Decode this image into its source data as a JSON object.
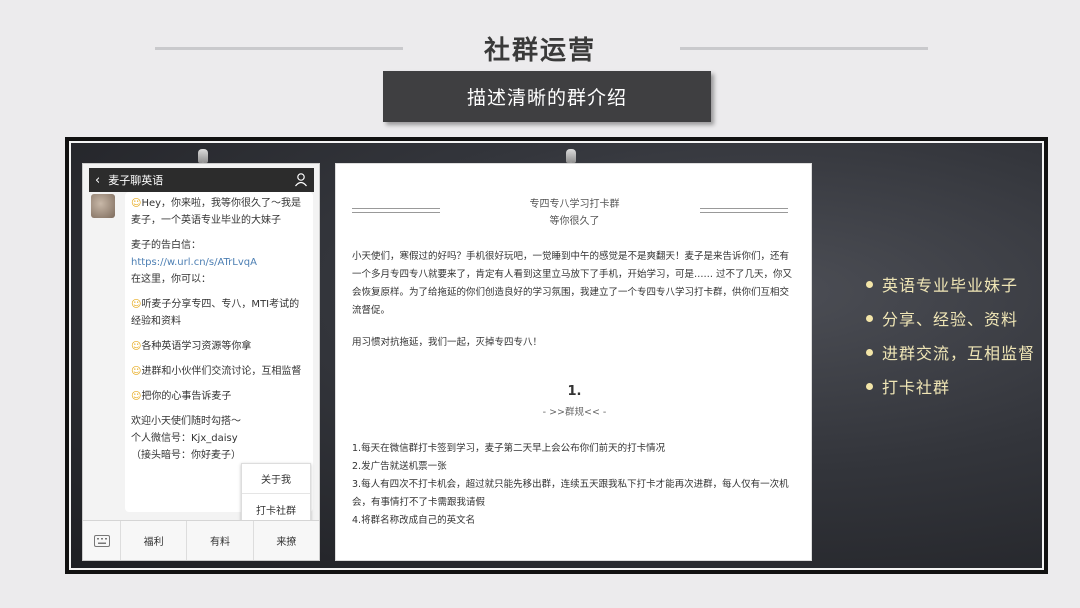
{
  "slide": {
    "title": "社群运营",
    "subtitle": "描述清晰的群介绍"
  },
  "phone": {
    "header_title": "麦子聊英语",
    "message": [
      "Hey，你来啦，我等你很久了～我是麦子，一个英语专业毕业的大妹子",
      "麦子的告白信：",
      "https://w.url.cn/s/ATrLvqA",
      "在这里，你可以：",
      "听麦子分享专四、专八，MTI考试的经验和资料",
      "各种英语学习资源等你拿",
      "进群和小伙伴们交流讨论，互相监督",
      "把你的心事告诉麦子",
      "欢迎小天使们随时勾搭～",
      "个人微信号：Kjx_daisy",
      "（接头暗号：你好麦子）"
    ],
    "popup_items": [
      "关于我",
      "打卡社群"
    ],
    "bottom_tabs": [
      "福利",
      "有料",
      "来撩"
    ]
  },
  "doc": {
    "title_line1": "专四专八学习打卡群",
    "title_line2": "等你很久了",
    "para1": "小天使们，寒假过的好吗？手机很好玩吧，一觉睡到中午的感觉是不是爽翻天！麦子是来告诉你们，还有一个多月专四专八就要来了，肯定有人看到这里立马放下了手机，开始学习，可是…… 过不了几天，你又会恢复原样。为了给拖延的你们创造良好的学习氛围，我建立了一个专四专八学习打卡群，供你们互相交流督促。",
    "para2": "用习惯对抗拖延，我们一起，灭掉专四专八！",
    "rule_number": "1.",
    "rule_label": "- >>群规<< -",
    "rules": [
      "1.每天在微信群打卡签到学习，麦子第二天早上会公布你们前天的打卡情况",
      "2.发广告就送机票一张",
      "3.每人有四次不打卡机会，超过就只能先移出群，连续五天跟我私下打卡才能再次进群，每人仅有一次机会，有事情打不了卡需跟我请假",
      "4.将群名称改成自己的英文名"
    ]
  },
  "bullets": [
    "英语专业毕业妹子",
    "分享、经验、资料",
    "进群交流，互相监督",
    "打卡社群"
  ],
  "colors": {
    "background": "#ecebed",
    "subtitle_box": "#3f3f41",
    "board": "#33353b",
    "bullet_text": "#f0e6b6"
  }
}
